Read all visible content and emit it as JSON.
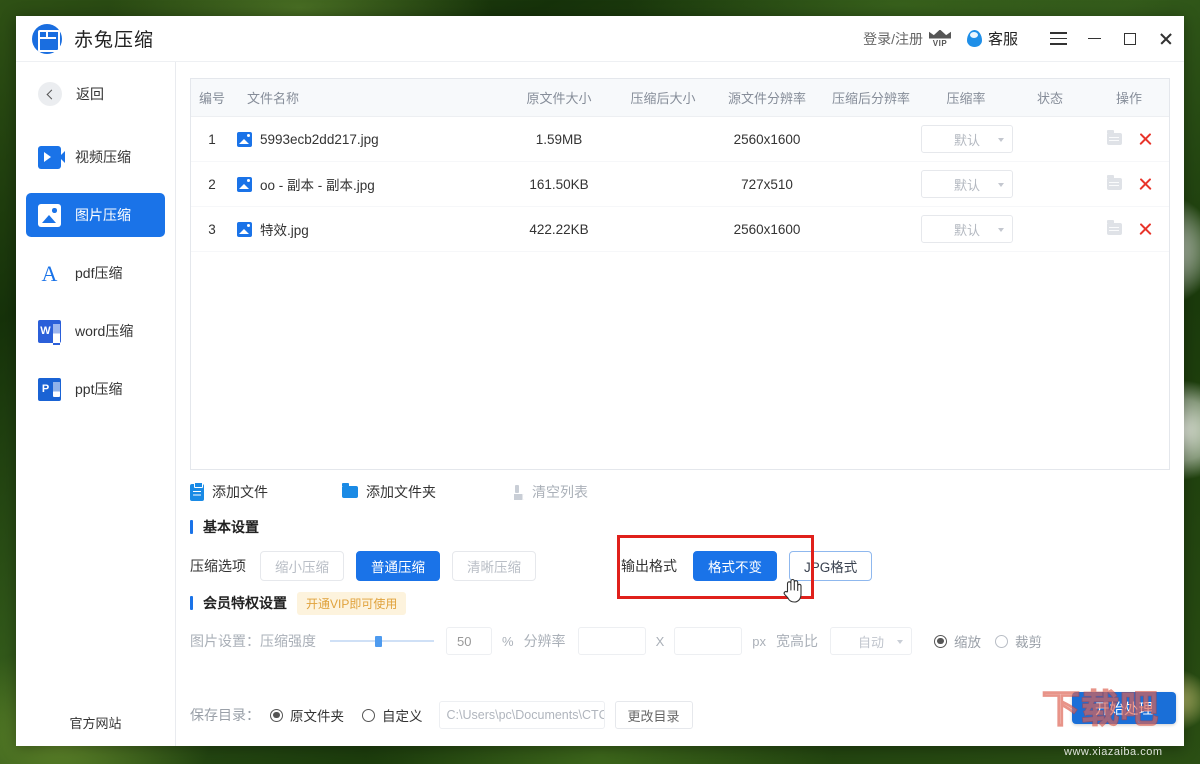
{
  "app": {
    "brand_name": "赤兔压缩",
    "logo_icon": "grid-logo-icon"
  },
  "titlebar": {
    "login_label": "登录/注册",
    "vip_icon": "vip-crown-icon",
    "vip_text": "VIP",
    "service_label": "客服",
    "service_icon": "water-drop-icon",
    "menu_icon": "hamburger-icon",
    "minimize_icon": "minimize-icon",
    "maximize_icon": "maximize-icon",
    "close_icon": "close-icon"
  },
  "sidebar": {
    "back_label": "返回",
    "back_icon": "chevron-left-icon",
    "items": [
      {
        "label": "视频压缩",
        "icon": "video-icon",
        "active": false
      },
      {
        "label": "图片压缩",
        "icon": "image-icon",
        "active": true
      },
      {
        "label": "pdf压缩",
        "icon": "pdf-icon",
        "active": false
      },
      {
        "label": "word压缩",
        "icon": "word-icon",
        "active": false
      },
      {
        "label": "ppt压缩",
        "icon": "ppt-icon",
        "active": false
      }
    ],
    "site_link": "官方网站"
  },
  "table": {
    "headers": {
      "index": "编号",
      "filename": "文件名称",
      "orig_size": "原文件大小",
      "comp_size": "压缩后大小",
      "orig_res": "源文件分辨率",
      "comp_res": "压缩后分辨率",
      "ratio": "压缩率",
      "status": "状态",
      "action": "操作"
    },
    "rows": [
      {
        "index": "1",
        "filename": "5993ecb2dd217.jpg",
        "orig_size": "1.59MB",
        "comp_size": "",
        "orig_res": "2560x1600",
        "comp_res": "",
        "ratio": "默认",
        "status": "",
        "open_icon": "open-folder-icon",
        "delete_icon": "delete-x-icon"
      },
      {
        "index": "2",
        "filename": "oo - 副本 - 副本.jpg",
        "orig_size": "161.50KB",
        "comp_size": "",
        "orig_res": "727x510",
        "comp_res": "",
        "ratio": "默认",
        "status": "",
        "open_icon": "open-folder-icon",
        "delete_icon": "delete-x-icon"
      },
      {
        "index": "3",
        "filename": "特效.jpg",
        "orig_size": "422.22KB",
        "comp_size": "",
        "orig_res": "2560x1600",
        "comp_res": "",
        "ratio": "默认",
        "status": "",
        "open_icon": "open-folder-icon",
        "delete_icon": "delete-x-icon"
      }
    ]
  },
  "file_actions": {
    "add_file": "添加文件",
    "add_file_icon": "document-add-icon",
    "add_folder": "添加文件夹",
    "add_folder_icon": "folder-add-icon",
    "clear_list": "清空列表",
    "clear_list_icon": "broom-icon"
  },
  "basic_settings": {
    "section_title": "基本设置",
    "compress_label": "压缩选项",
    "options": [
      {
        "label": "缩小压缩",
        "selected": false
      },
      {
        "label": "普通压缩",
        "selected": true
      },
      {
        "label": "清晰压缩",
        "selected": false
      }
    ],
    "format_label": "输出格式",
    "formats": [
      {
        "label": "格式不变",
        "selected": true
      },
      {
        "label": "JPG格式",
        "selected": false
      }
    ],
    "highlight_color": "#e0201b",
    "accent_color": "#1a73e8"
  },
  "vip_settings": {
    "section_title": "会员特权设置",
    "vip_badge": "开通VIP即可使用",
    "image_settings_label": "图片设置：压缩强度",
    "strength_value": "50",
    "percent_unit": "%",
    "resolution_label": "分辨率",
    "res_width": "",
    "res_height": "",
    "res_separator": "X",
    "px_unit": "px",
    "aspect_label": "宽高比",
    "aspect_value": "自动",
    "modes": [
      {
        "label": "缩放",
        "selected": true
      },
      {
        "label": "裁剪",
        "selected": false
      }
    ]
  },
  "bottom": {
    "save_dir_label": "保存目录：",
    "dir_options": [
      {
        "label": "原文件夹",
        "selected": true
      },
      {
        "label": "自定义",
        "selected": false
      }
    ],
    "path_value": "C:\\Users\\pc\\Documents\\CTCom",
    "change_dir": "更改目录",
    "start_button": "开始处理"
  },
  "watermark": {
    "big": "下载吧",
    "small": "www.xiazaiba.com"
  }
}
